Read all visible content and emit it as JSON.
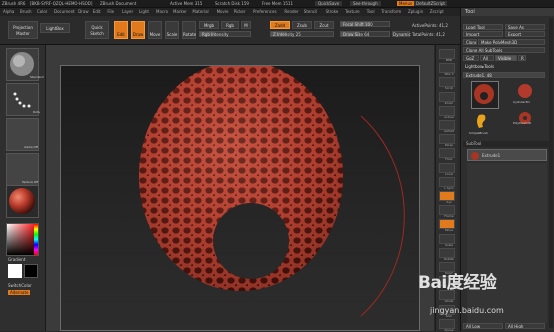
{
  "titlebar": {
    "items": [
      "ZBrush 4R6",
      "[BKB-SYRF-QZQL-HEMO-HSOD]",
      "ZBrush Document",
      "Free Mem 1511",
      "Active Mem 315",
      "Scratch Disk 159",
      "Ztime 25.65",
      "Timer 5.2"
    ],
    "buttons": [
      "QuickSave",
      "See-through",
      "Menus",
      "DefaultZScript"
    ]
  },
  "menubar": [
    "Alpha",
    "Brush",
    "Color",
    "Document",
    "Draw",
    "Edit",
    "File",
    "Layer",
    "Light",
    "Macro",
    "Marker",
    "Material",
    "Movie",
    "Picker",
    "Preferences",
    "Render",
    "Stencil",
    "Stroke",
    "Texture",
    "Tool",
    "Transform",
    "Zplugin",
    "Zscript"
  ],
  "toolbar": {
    "projection_master": "Projection Master",
    "lightbox": "LightBox",
    "quick_sketch": "Quick Sketch",
    "edit": "Edit",
    "draw": "Draw",
    "move": "Move",
    "scale": "Scale",
    "rotate": "Rotate",
    "mrgb": "Mrgb",
    "rgb": "Rgb",
    "m": "M",
    "rgb_intensity": "Rgb Intensity",
    "zadd": "Zadd",
    "zsub": "Zsub",
    "zcut": "Zcut",
    "z_intensity": "Z Intensity 25",
    "focal_shift": "Focal Shift 100",
    "draw_size": "Draw Size 64",
    "dynamic": "Dynamic",
    "active_points": "ActivePoints: 41,2",
    "total_points": "TotalPoints: 41,2"
  },
  "leftshelf": {
    "labels": [
      "Standard",
      "Dots",
      "Alpha Off",
      "Texture Off",
      "MatCap Red",
      "Gradient",
      "SwitchColor",
      "Alternate"
    ],
    "colors": {
      "accent": "#e07a1c",
      "material": "#b83a2a"
    }
  },
  "righticons": [
    "BPR",
    "SPix 3",
    "Scroll",
    "Zoom",
    "Actual",
    "AAHalf",
    "Persp",
    "Floor",
    "Local",
    "L.Sym",
    "Xyz",
    "Frame",
    "Move",
    "Scale",
    "Rotate",
    "PolyF",
    "Transp",
    "Ghost",
    "Solo",
    "Xpose"
  ],
  "rightpanel": {
    "title": "Tool",
    "load_tool": "Load Tool",
    "save_as": "Save As",
    "import": "Import",
    "export": "Export",
    "clone": "Clone",
    "make_polymesh": "Make PolyMesh3D",
    "clone_all": "Clone All SubTools",
    "goz": "GoZ",
    "all": "All",
    "visible": "Visible",
    "r": "R",
    "lightbox_tools": "Lightbox▸Tools",
    "extrude_tool": "Extrude1. 48",
    "extrude_label": "Extrude1",
    "cylinder": "Cylinder3D",
    "polymesh": "PolyMesh3D",
    "simplebrush": "SimpleBrush",
    "subtool": "SubTool",
    "all_low": "All Low",
    "all_high": "All High"
  },
  "watermark": {
    "brand": "Bai度经验",
    "url": "jingyan.baidu.com"
  }
}
